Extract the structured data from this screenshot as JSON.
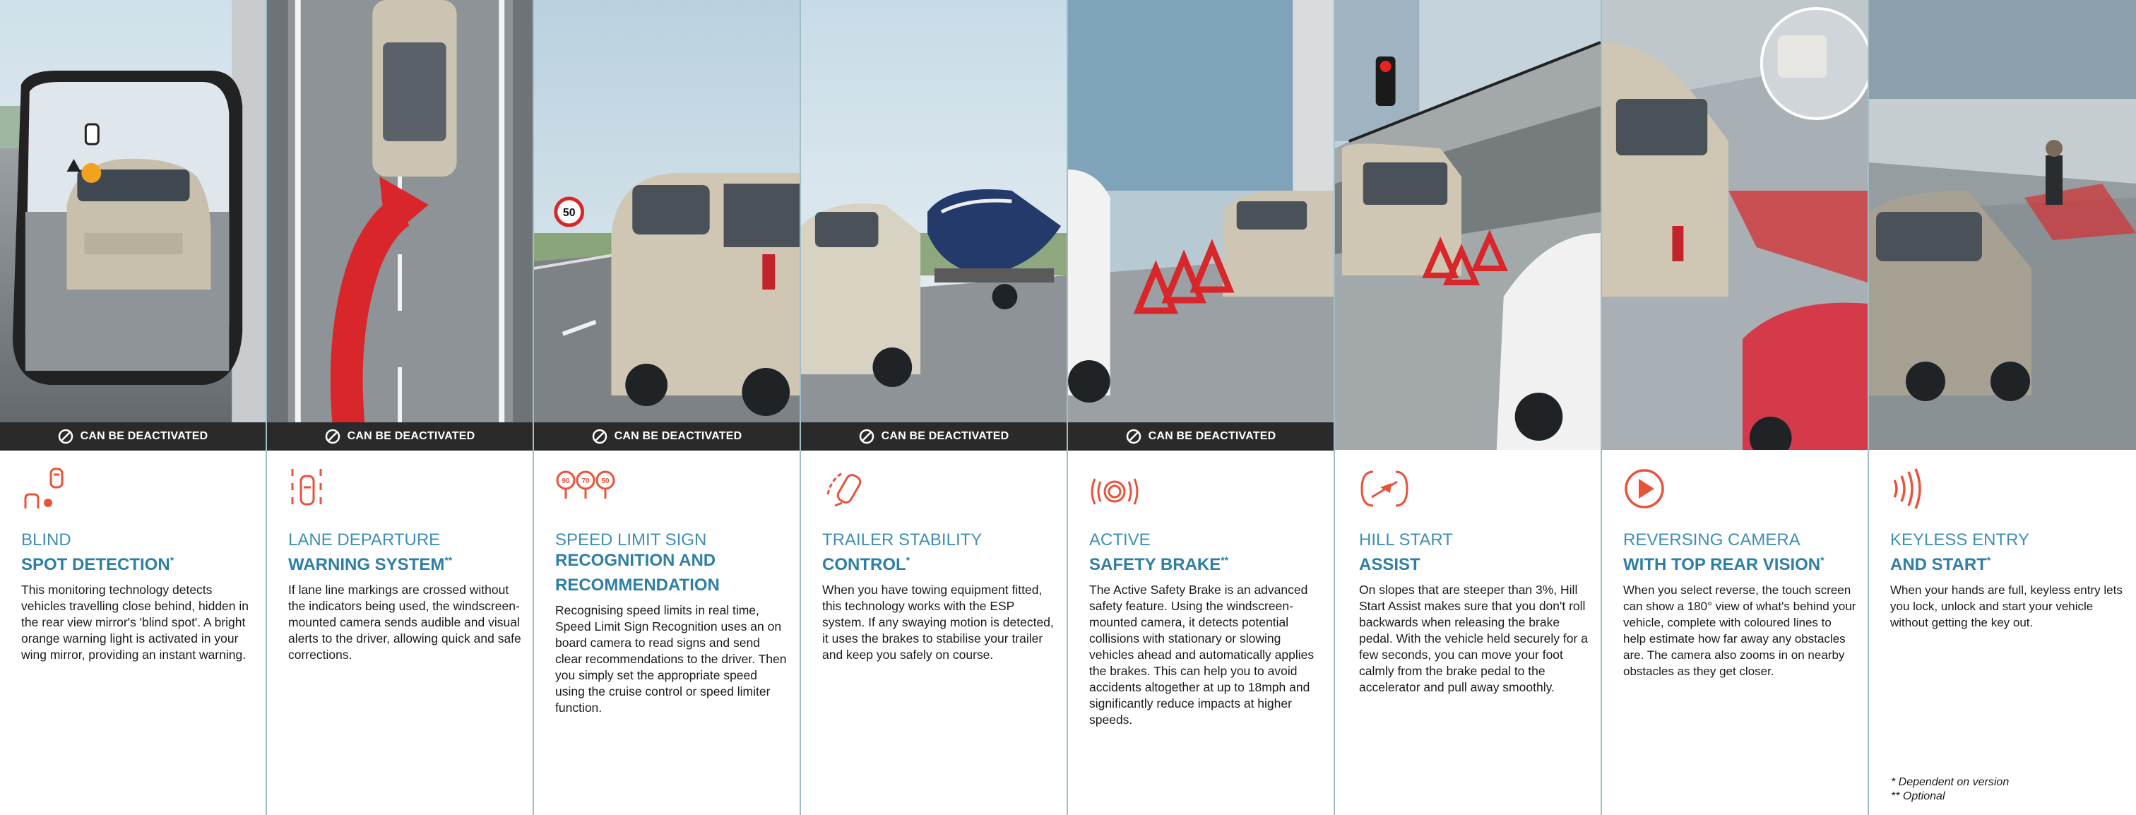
{
  "deactivate_label": "CAN BE DEACTIVATED",
  "accent_color": "#e8533a",
  "title_color_light": "#3f8fb3",
  "title_color_bold": "#2e7ea5",
  "features": [
    {
      "icon": "blind-spot-icon",
      "title_line1": "BLIND",
      "title_line2": "SPOT DETECTION",
      "marker": "*",
      "can_be_deactivated": true,
      "description": "This monitoring technology detects vehicles travelling close behind, hidden in the rear view mirror's 'blind spot'. A bright orange warning light is activated in your wing mirror, providing an instant warning."
    },
    {
      "icon": "lane-departure-icon",
      "title_line1": "LANE DEPARTURE",
      "title_line2": "WARNING SYSTEM",
      "marker": "**",
      "can_be_deactivated": true,
      "description": "If lane line markings are crossed without the indicators being used, the windscreen-mounted camera sends audible and visual alerts to the driver, allowing quick and safe corrections."
    },
    {
      "icon": "speed-limit-icon",
      "title_line1": "SPEED LIMIT SIGN",
      "title_line2": "RECOGNITION AND RECOMMENDATION",
      "marker": "",
      "can_be_deactivated": true,
      "description": "Recognising speed limits in real time, Speed Limit Sign Recognition uses an on board camera to read signs and send clear recommendations to the driver. Then you simply set the appropriate speed using the cruise control or speed limiter function."
    },
    {
      "icon": "trailer-stability-icon",
      "title_line1": "TRAILER STABILITY",
      "title_line2": "CONTROL",
      "marker": "*",
      "can_be_deactivated": true,
      "description": "When you have towing equipment fitted, this technology works with the ESP system. If any swaying motion is detected, it uses the brakes to stabilise your trailer and keep you safely on course."
    },
    {
      "icon": "active-brake-icon",
      "title_line1": "ACTIVE",
      "title_line2": "SAFETY BRAKE",
      "marker": "**",
      "can_be_deactivated": true,
      "description": "The Active Safety Brake is an advanced safety feature. Using the windscreen-mounted camera, it detects potential collisions with stationary or slowing vehicles ahead and automatically applies the brakes. This can help you to avoid accidents altogether at up to 18mph and significantly reduce impacts at higher speeds."
    },
    {
      "icon": "hill-start-icon",
      "title_line1": "HILL START",
      "title_line2": "ASSIST",
      "marker": "",
      "can_be_deactivated": false,
      "description": "On slopes that are steeper than 3%, Hill Start Assist makes sure that you don't roll backwards when releasing the brake pedal. With the vehicle held securely for a few seconds, you can move your foot calmly from the brake pedal to the accelerator and pull away smoothly."
    },
    {
      "icon": "reversing-camera-icon",
      "title_line1": "REVERSING CAMERA",
      "title_line2": "WITH TOP REAR VISION",
      "marker": "*",
      "can_be_deactivated": false,
      "description": "When you select reverse, the touch screen can show a 180° view of what's behind your vehicle, complete with coloured lines to help estimate how far away any obstacles are. The camera also zooms in on nearby obstacles as they get closer."
    },
    {
      "icon": "keyless-entry-icon",
      "title_line1": "KEYLESS ENTRY",
      "title_line2": "AND START",
      "marker": "*",
      "can_be_deactivated": false,
      "description": "When your hands are full, keyless entry lets you lock, unlock and start your vehicle without getting the key out."
    }
  ],
  "speed_signs": [
    "90",
    "70",
    "50"
  ],
  "road_sign_value": "50",
  "footnotes": {
    "line1": "* Dependent on version",
    "line2": "** Optional"
  }
}
